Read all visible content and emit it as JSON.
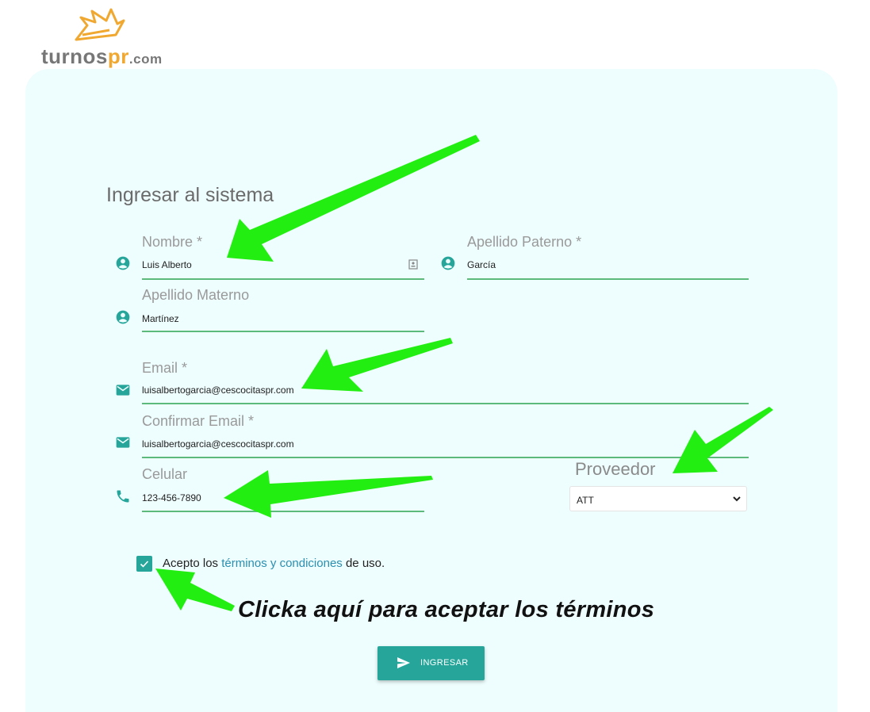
{
  "brand": {
    "part1": "turnos",
    "part2": "pr",
    "part3": ".com",
    "primary_color": "#f0a830"
  },
  "form": {
    "title": "Ingresar al sistema",
    "nombre": {
      "label": "Nombre *",
      "value": "Luis Alberto",
      "icon": "account-circle-icon",
      "suffix_icon": "contact-card-icon"
    },
    "apellido_paterno": {
      "label": "Apellido Paterno *",
      "value": "García",
      "icon": "account-circle-icon"
    },
    "apellido_materno": {
      "label": "Apellido Materno",
      "value": "Martínez",
      "icon": "account-circle-icon"
    },
    "email": {
      "label": "Email *",
      "value": "luisalbertogarcia@cescocitaspr.com",
      "icon": "mail-icon"
    },
    "confirm_email": {
      "label": "Confirmar Email *",
      "value": "luisalbertogarcia@cescocitaspr.com",
      "icon": "mail-icon"
    },
    "celular": {
      "label": "Celular",
      "value": "123-456-7890",
      "icon": "phone-icon"
    },
    "proveedor": {
      "label": "Proveedor",
      "selected": "ATT"
    },
    "terms": {
      "checked": true,
      "prefix": "Acepto los",
      "link": "términos y condiciones",
      "suffix": "de uso."
    },
    "submit_label": "INGRESAR"
  },
  "annotation": {
    "text": "Clicka aquí para aceptar los términos",
    "arrow_color": "#22ee11"
  },
  "colors": {
    "accent": "#26a69a",
    "underline": "#5cbb7b",
    "card_bg": "#eefdfd"
  }
}
